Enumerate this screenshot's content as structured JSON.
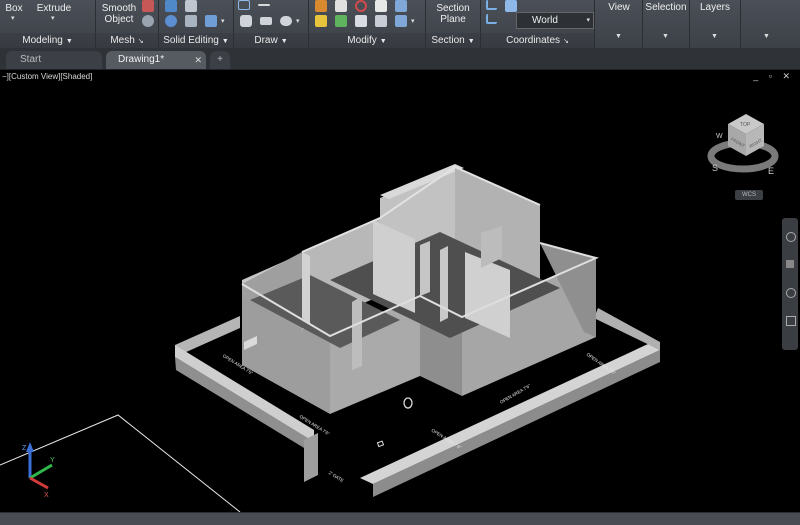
{
  "ribbon": {
    "buttons": {
      "box": "Box",
      "extrude": "Extrude",
      "smooth_object_line1": "Smooth",
      "smooth_object_line2": "Object",
      "section_plane_line1": "Section",
      "section_plane_line2": "Plane"
    },
    "panels": [
      {
        "id": "modeling",
        "label": "Modeling"
      },
      {
        "id": "mesh",
        "label": "Mesh"
      },
      {
        "id": "solid-editing",
        "label": "Solid Editing"
      },
      {
        "id": "draw",
        "label": "Draw"
      },
      {
        "id": "modify",
        "label": "Modify"
      },
      {
        "id": "section",
        "label": "Section"
      },
      {
        "id": "coordinates",
        "label": "Coordinates"
      }
    ],
    "coordinate_system": "World",
    "big_panels": {
      "view": "View",
      "selection": "Selection",
      "layers": "Layers"
    }
  },
  "tabs": {
    "start": "Start",
    "drawing": "Drawing1*",
    "add": "+"
  },
  "viewport": {
    "label": "−][Custom View][Shaded]",
    "window_controls": "_ ▫ ✕",
    "viewcube": {
      "top": "TOP",
      "front": "FRONT",
      "right": "RIGHT",
      "south": "S",
      "east": "E",
      "west": "W"
    },
    "wcs_button": "WCS",
    "annotations": [
      "OPEN AREA 7'6\"",
      "OPEN AREA 7'6\"",
      "OPEN AREA 7'6\"",
      "OPEN AREA 7'6\"",
      "OPEN AREA 7'6\"",
      "2' GATE"
    ]
  },
  "colors": {
    "ribbon": "#43474e",
    "viewport": "#000000",
    "walls_light": "#b4b4b4",
    "walls_mid": "#9a9a9a",
    "walls_dark": "#7c7c7c"
  }
}
